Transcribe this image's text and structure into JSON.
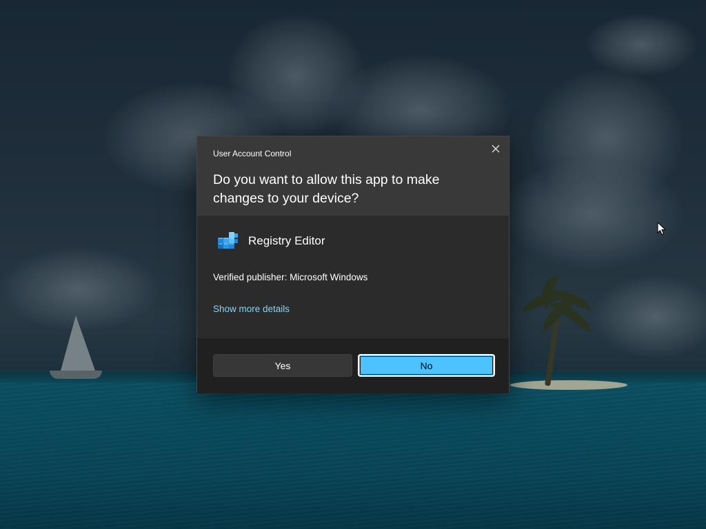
{
  "dialog": {
    "title": "User Account Control",
    "question": "Do you want to allow this app to make changes to your device?",
    "app_name": "Registry Editor",
    "app_icon": "registry-editor-icon",
    "publisher": "Verified publisher: Microsoft Windows",
    "more_details_link": "Show more details",
    "close_icon": "close-icon",
    "yes_label": "Yes",
    "no_label": "No",
    "accent_color": "#4cc2ff",
    "link_color": "#8cd3f2"
  },
  "pointer": {
    "icon": "mouse-cursor-icon"
  }
}
